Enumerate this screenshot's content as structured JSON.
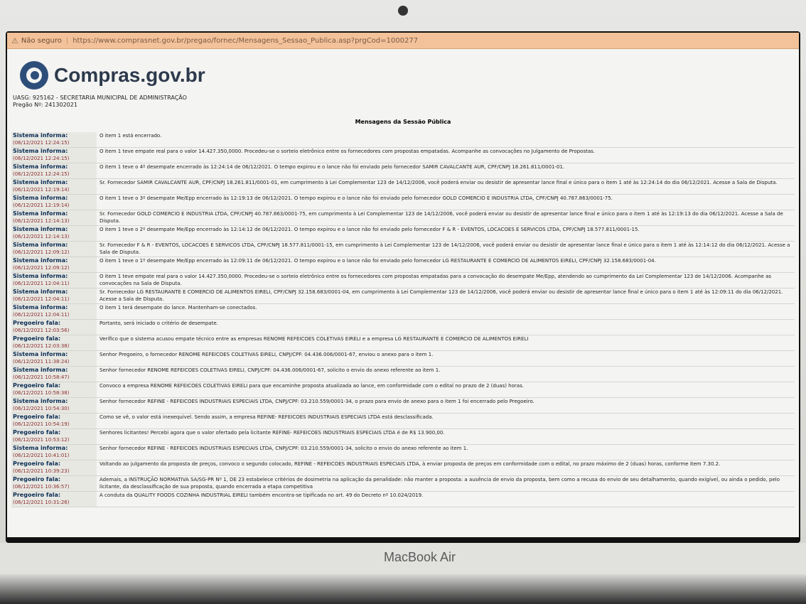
{
  "browser": {
    "security_label": "Não seguro",
    "url": "https://www.comprasnet.gov.br/pregao/fornec/Mensagens_Sessao_Publica.asp?prgCod=1000277"
  },
  "site": {
    "logo_text": "Compras.gov.br"
  },
  "header": {
    "uasg": "UASG: 925162 - SECRETARIA MUNICIPAL DE ADMINISTRAÇÃO",
    "pregao": "Pregão Nº: 241302021"
  },
  "page": {
    "title": "Mensagens da Sessão Pública"
  },
  "messages": [
    {
      "sender": "Sistema informa:",
      "time": "(06/12/2021 12:24:15)",
      "text": "O item 1 está encerrado."
    },
    {
      "sender": "Sistema informa:",
      "time": "(06/12/2021 12:24:15)",
      "text": "O item 1 teve empate real para o valor 14.427.350,0000. Procedeu-se o sorteio eletrônico entre os fornecedores com propostas empatadas. Acompanhe as convocações no Julgamento de Propostas."
    },
    {
      "sender": "Sistema informa:",
      "time": "(06/12/2021 12:24:15)",
      "text": "O item 1 teve o 4º desempate encerrado às 12:24:14 de 06/12/2021. O tempo expirou e o lance não foi enviado pelo fornecedor SAMIR CAVALCANTE AUR, CPF/CNPJ 18.261.811/0001-01."
    },
    {
      "sender": "Sistema informa:",
      "time": "(06/12/2021 12:19:14)",
      "text": "Sr. Fornecedor SAMIR CAVALCANTE AUR, CPF/CNPJ 18.261.811/0001-01, em cumprimento à Lei Complementar 123 de 14/12/2006, você poderá enviar ou desistir de apresentar lance final e único para o item 1 até às 12:24:14 do dia 06/12/2021. Acesse a Sala de Disputa."
    },
    {
      "sender": "Sistema informa:",
      "time": "(06/12/2021 12:19:14)",
      "text": "O item 1 teve o 3º desempate Me/Epp encerrado às 12:19:13 de 06/12/2021. O tempo expirou e o lance não foi enviado pelo fornecedor GOLD COMERCIO E INDUSTRIA LTDA, CPF/CNPJ 40.787.863/0001-75."
    },
    {
      "sender": "Sistema informa:",
      "time": "(06/12/2021 12:14:13)",
      "text": "Sr. Fornecedor GOLD COMERCIO E INDUSTRIA LTDA, CPF/CNPJ 40.787.863/0001-75, em cumprimento à Lei Complementar 123 de 14/12/2006, você poderá enviar ou desistir de apresentar lance final e único para o item 1 até às 12:19:13 do dia 06/12/2021. Acesse a Sala de Disputa."
    },
    {
      "sender": "Sistema informa:",
      "time": "(06/12/2021 12:14:13)",
      "text": "O item 1 teve o 2º desempate Me/Epp encerrado às 12:14:12 de 06/12/2021. O tempo expirou e o lance não foi enviado pelo fornecedor F & R - EVENTOS, LOCACOES E SERVICOS LTDA, CPF/CNPJ 18.577.811/0001-15."
    },
    {
      "sender": "Sistema informa:",
      "time": "(06/12/2021 12:09:12)",
      "text": "Sr. Fornecedor F & R - EVENTOS, LOCACOES E SERVICOS LTDA, CPF/CNPJ 18.577.811/0001-15, em cumprimento à Lei Complementar 123 de 14/12/2006, você poderá enviar ou desistir de apresentar lance final e único para o item 1 até às 12:14:12 do dia 06/12/2021. Acesse a Sala de Disputa."
    },
    {
      "sender": "Sistema informa:",
      "time": "(06/12/2021 12:09:12)",
      "text": "O item 1 teve o 1º desempate Me/Epp encerrado às 12:09:11 de 06/12/2021. O tempo expirou e o lance não foi enviado pelo fornecedor LG RESTAURANTE E COMERCIO DE ALIMENTOS EIRELI, CPF/CNPJ 32.158.683/0001-04."
    },
    {
      "sender": "Sistema informa:",
      "time": "(06/12/2021 12:04:11)",
      "text": "O item 1 teve empate real para o valor 14.427.350,0000. Procedeu-se o sorteio eletrônico entre os fornecedores com propostas empatadas para a convocação do desempate Me/Epp, atendendo ao cumprimento da Lei Complementar 123 de 14/12/2006. Acompanhe as convocações na Sala de Disputa."
    },
    {
      "sender": "Sistema informa:",
      "time": "(06/12/2021 12:04:11)",
      "text": "Sr. Fornecedor LG RESTAURANTE E COMERCIO DE ALIMENTOS EIRELI, CPF/CNPJ 32.158.683/0001-04, em cumprimento à Lei Complementar 123 de 14/12/2006, você poderá enviar ou desistir de apresentar lance final e único para o item 1 até às 12:09:11 do dia 06/12/2021. Acesse a Sala de Disputa."
    },
    {
      "sender": "Sistema informa:",
      "time": "(06/12/2021 12:04:11)",
      "text": "O item 1 terá desempate do lance. Mantenham-se conectados."
    },
    {
      "sender": "Pregoeiro fala:",
      "time": "(06/12/2021 12:03:56)",
      "text": "Portanto, será iniciado o critério de desempate."
    },
    {
      "sender": "Pregoeiro fala:",
      "time": "(06/12/2021 12:03:38)",
      "text": "Verifico que o sistema acusou empate técnico entre as empresas RENOME REFEICOES COLETIVAS EIRELI e a empresa LG RESTAURANTE E COMERCIO DE ALIMENTOS EIRELI"
    },
    {
      "sender": "Sistema informa:",
      "time": "(06/12/2021 11:38:24)",
      "text": "Senhor Pregoeiro, o fornecedor RENOME REFEICOES COLETIVAS EIRELI, CNPJ/CPF: 04.436.006/0001-67, enviou o anexo para o item 1."
    },
    {
      "sender": "Sistema informa:",
      "time": "(06/12/2021 10:58:47)",
      "text": "Senhor fornecedor RENOME REFEICOES COLETIVAS EIRELI, CNPJ/CPF: 04.436.006/0001-67, solicito o envio do anexo referente ao item 1."
    },
    {
      "sender": "Pregoeiro fala:",
      "time": "(06/12/2021 10:58:38)",
      "text": "Convoco a empresa RENOME REFEICOES COLETIVAS EIRELI para que encaminhe proposta atualizada ao lance, em conformidade com o edital no prazo de 2 (duas) horas."
    },
    {
      "sender": "Sistema informa:",
      "time": "(06/12/2021 10:54:30)",
      "text": "Senhor fornecedor REFINE - REFEICOES INDUSTRIAIS ESPECIAIS LTDA, CNPJ/CPF: 03.210.559/0001-34, o prazo para envio de anexo para o item 1 foi encerrado pelo Pregoeiro."
    },
    {
      "sender": "Pregoeiro fala:",
      "time": "(06/12/2021 10:54:19)",
      "text": "Como se vê, o valor está inexequível. Sendo assim, a empresa REFINE- REFEICOES INDUSTRIAIS ESPECIAIS LTDA está desclassificada."
    },
    {
      "sender": "Pregoeiro fala:",
      "time": "(06/12/2021 10:53:12)",
      "text": "Senhores licitantes! Percebi agora que o valor ofertado pela licitante REFINE- REFEICOES INDUSTRIAIS ESPECIAIS LTDA é de R$ 13.900,00."
    },
    {
      "sender": "Sistema informa:",
      "time": "(06/12/2021 10:41:01)",
      "text": "Senhor fornecedor REFINE - REFEICOES INDUSTRIAIS ESPECIAIS LTDA, CNPJ/CPF: 03.210.559/0001-34, solicito o envio do anexo referente ao item 1."
    },
    {
      "sender": "Pregoeiro fala:",
      "time": "(06/12/2021 10:39:23)",
      "text": "Voltando ao julgamento da proposta de preços, convoco o segundo colocado, REFINE - REFEICOES INDUSTRIAIS ESPECIAIS LTDA, à enviar proposta de preços em conformidade com o edital, no prazo máximo de 2 (duas) horas, conforme item 7.30.2."
    },
    {
      "sender": "Pregoeiro fala:",
      "time": "(06/12/2021 10:36:57)",
      "text": "Ademais, a INSTRUÇÃO NORMATIVA SA/SG-PR Nº 1, DE 23 estabelece critérios de dosimetria na aplicação da penalidade: não manter a proposta: a ausência de envio da proposta, bem como a recusa do envio de seu detalhamento, quando exigível, ou ainda o pedido, pelo licitante, da desclassificação de sua proposta, quando encerrada a etapa competitiva"
    },
    {
      "sender": "Pregoeiro fala:",
      "time": "(06/12/2021 10:31:26)",
      "text": "A conduta da QUALITY FOODS COZINHA INDUSTRIAL EIRELI também encontra-se tipificada no art. 49 do Decreto nº 10.024/2019."
    }
  ],
  "device": {
    "brand": "MacBook Air"
  }
}
